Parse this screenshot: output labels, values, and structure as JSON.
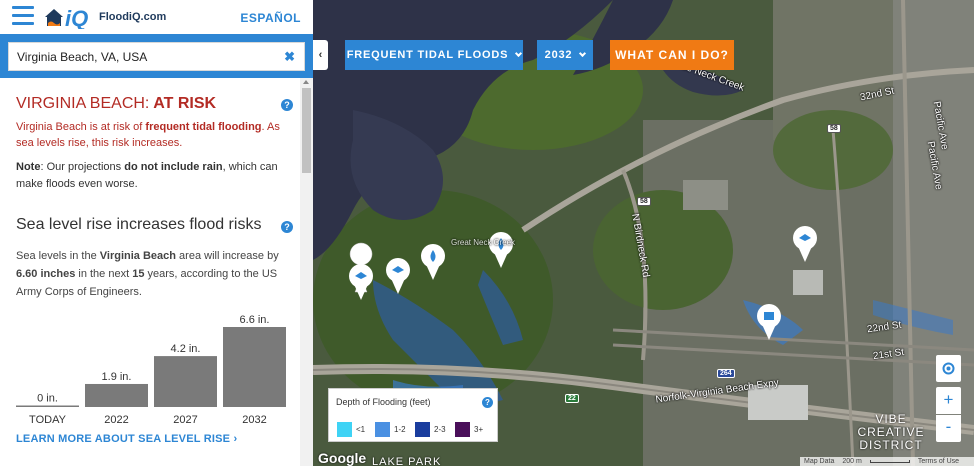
{
  "header": {
    "logo_text": "FloodiQ.com",
    "language_link": "ESPAÑOL"
  },
  "search": {
    "value": "Virginia Beach, VA, USA",
    "placeholder": ""
  },
  "risk": {
    "title_place": "VIRGINIA BEACH:",
    "title_status": " AT RISK",
    "desc_pre": "Virginia Beach is at risk of ",
    "desc_bold": "frequent tidal flooding",
    "desc_post": ". As sea levels rise, this risk increases.",
    "note_label": "Note",
    "note_pre": ": Our projections ",
    "note_bold": "do not include rain",
    "note_post": ", which can make floods even worse."
  },
  "sea_level": {
    "title": "Sea level rise increases flood risks",
    "d1": "Sea levels in the ",
    "d2": "Virginia Beach",
    "d3": " area will increase by ",
    "d4": "6.60 inches",
    "d5": " in the next ",
    "d6": "15",
    "d7": " years, according to the US Army Corps of Engineers.",
    "learn_more": "LEARN MORE ABOUT SEA LEVEL RISE ›"
  },
  "chart_data": {
    "type": "bar",
    "categories": [
      "TODAY",
      "2022",
      "2027",
      "2032"
    ],
    "values": [
      0,
      1.9,
      4.2,
      6.6
    ],
    "data_labels": [
      "0 in.",
      "1.9 in.",
      "4.2 in.",
      "6.6 in."
    ],
    "title": "",
    "xlabel": "",
    "ylabel": "",
    "ylim": [
      0,
      6.6
    ],
    "color": "#7a7a7a"
  },
  "map": {
    "scenario_label": "FREQUENT TIDAL FLOODS",
    "year_label": "2032",
    "action_label": "WHAT CAN I DO?",
    "collapse_glyph": "‹",
    "zoom_in": "+",
    "zoom_out": "-",
    "legend": {
      "title": "Depth of Flooding (feet)",
      "items": [
        {
          "label": "<1",
          "color": "#3fd3f5"
        },
        {
          "label": "1-2",
          "color": "#4a90e2"
        },
        {
          "label": "2-3",
          "color": "#1a3d9e"
        },
        {
          "label": "3+",
          "color": "#4a0f5a"
        }
      ]
    },
    "labels": {
      "little_neck": "Little Neck Creek",
      "st32": "32nd St",
      "pacific1": "Pacific Ave",
      "pacific2": "Pacific Ave",
      "birdneck": "N Birdneck Rd",
      "st22": "22nd St",
      "st21": "21st St",
      "expy": "Norfolk-Virginia Beach Expy",
      "great_neck": "Great Neck Creek",
      "vibe": "VIBE CREATIVE DISTRICT",
      "park": "LAKE PARK",
      "r58a": "58",
      "r58b": "58",
      "r264": "264",
      "r22": "22"
    },
    "google": "Google",
    "attribution": {
      "map_data": "Map Data",
      "scale": "200 m",
      "terms": "Terms of Use"
    }
  }
}
